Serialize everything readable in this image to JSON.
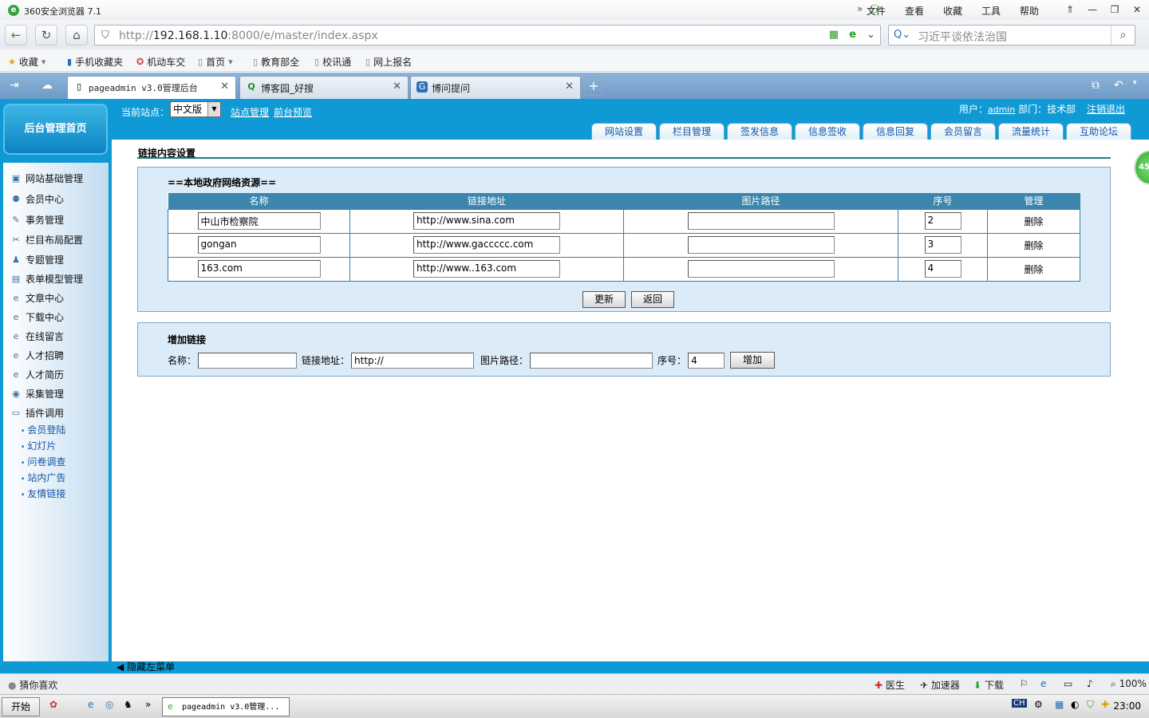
{
  "browser": {
    "title": "360安全浏览器 7.1",
    "menu": [
      "文件",
      "查看",
      "收藏",
      "工具",
      "帮助"
    ],
    "address_prefix": "http://",
    "address_host": "192.168.1.10",
    "address_rest": ":8000/e/master/index.aspx",
    "search_placeholder": "习近平谈依法治国",
    "bookmarks": [
      "收藏",
      "手机收藏夹",
      "机动车交",
      "首页",
      "教育部全",
      "校讯通",
      "网上报名"
    ],
    "tabs": [
      {
        "label": "pageadmin v3.0管理后台",
        "active": true
      },
      {
        "label": "博客园_好搜",
        "active": false
      },
      {
        "label": "博问提问",
        "active": false
      }
    ]
  },
  "admin": {
    "home_label": "后台管理首页",
    "site_label": "当前站点：",
    "site_value": "中文版",
    "site_manage": "站点管理",
    "preview": "前台预览",
    "user_label": "用户：",
    "user_name": "admin",
    "dept": "部门：技术部",
    "logout": "注销退出",
    "nav_tabs": [
      "网站设置",
      "栏目管理",
      "签发信息",
      "信息签收",
      "信息回复",
      "会员留言",
      "流量统计",
      "互助论坛"
    ],
    "menu": [
      "网站基础管理",
      "会员中心",
      "事务管理",
      "栏目布局配置",
      "专题管理",
      "表单模型管理",
      "文章中心",
      "下载中心",
      "在线留言",
      "人才招聘",
      "人才简历",
      "采集管理",
      "插件调用"
    ],
    "submenu": [
      "会员登陆",
      "幻灯片",
      "问卷调查",
      "站内广告",
      "友情链接"
    ],
    "hide_menu": "隐藏左菜单"
  },
  "content": {
    "section_title": "链接内容设置",
    "group_title": "==本地政府网络资源==",
    "columns": [
      "名称",
      "链接地址",
      "图片路径",
      "序号",
      "管理"
    ],
    "rows": [
      {
        "name": "中山市检察院",
        "url": "http://www.sina.com",
        "img": "",
        "order": "2",
        "action": "删除"
      },
      {
        "name": "gongan",
        "url": "http://www.gaccccc.com",
        "img": "",
        "order": "3",
        "action": "删除"
      },
      {
        "name": "163.com",
        "url": "http://www..163.com",
        "img": "",
        "order": "4",
        "action": "删除"
      }
    ],
    "update_btn": "更新",
    "back_btn": "返回",
    "add_title": "增加链接",
    "add_name_label": "名称：",
    "add_url_label": "链接地址：",
    "add_url_value": "http://",
    "add_img_label": "图片路径：",
    "add_order_label": "序号：",
    "add_order_value": "4",
    "add_btn": "增加"
  },
  "statusbar": {
    "left": "猜你喜欢",
    "items": [
      "医生",
      "加速器",
      "下载"
    ],
    "zoom": "100%"
  },
  "taskbar": {
    "start": "开始",
    "task": "pageadmin v3.0管理...",
    "lang": "CH",
    "time": "23:00"
  },
  "float_badge": "45"
}
